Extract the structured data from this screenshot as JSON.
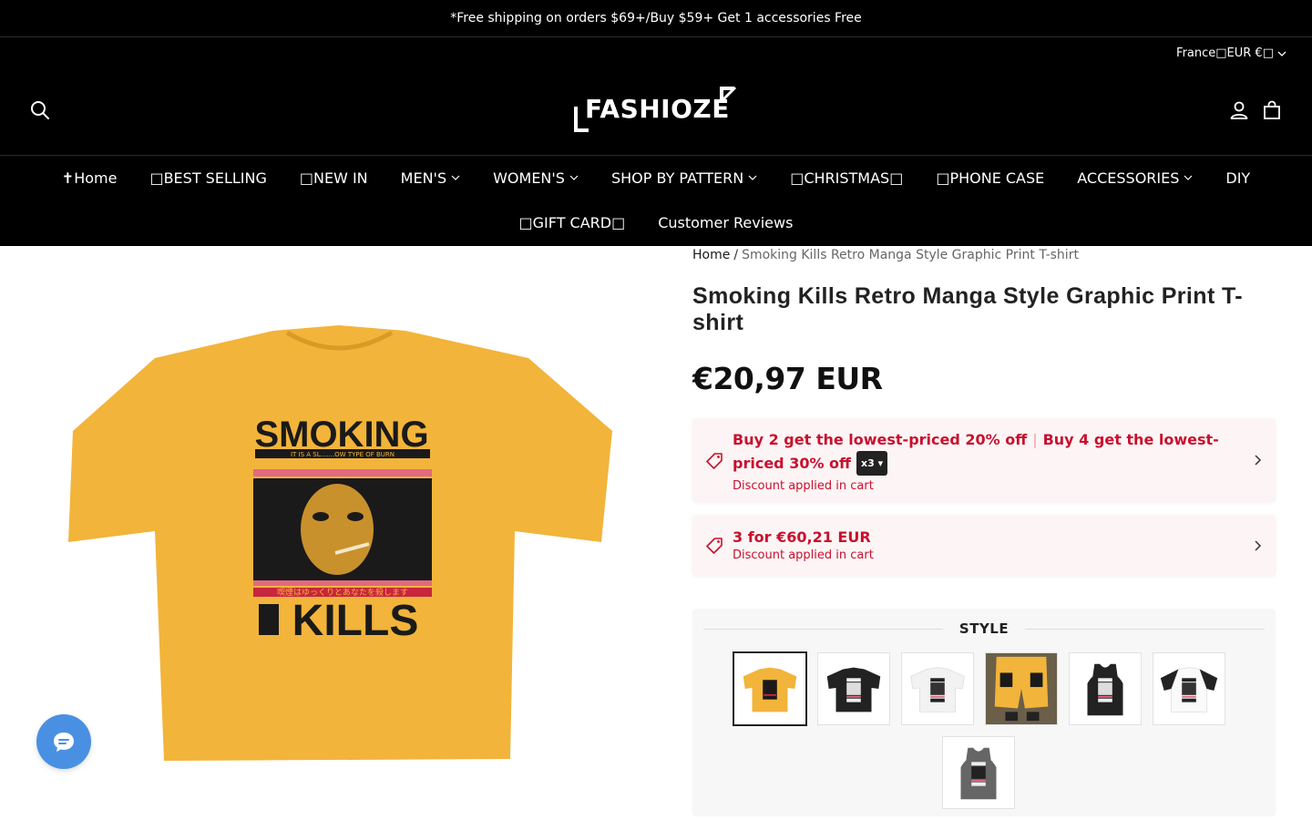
{
  "announcement": "*Free shipping on orders $69+/Buy $59+ Get 1 accessories Free",
  "header": {
    "currency": "France□EUR €□",
    "logo": "FASHIOZE"
  },
  "nav": {
    "row1": [
      {
        "label": "✝Home",
        "has_dropdown": false
      },
      {
        "label": "□BEST SELLING",
        "has_dropdown": false
      },
      {
        "label": "□NEW IN",
        "has_dropdown": false
      },
      {
        "label": "MEN'S",
        "has_dropdown": true
      },
      {
        "label": "WOMEN'S",
        "has_dropdown": true
      },
      {
        "label": "SHOP BY PATTERN",
        "has_dropdown": true
      },
      {
        "label": "□CHRISTMAS□",
        "has_dropdown": false
      },
      {
        "label": "□PHONE CASE",
        "has_dropdown": false
      },
      {
        "label": "ACCESSORIES",
        "has_dropdown": true
      },
      {
        "label": "DIY",
        "has_dropdown": false
      }
    ],
    "row2": [
      {
        "label": "□GIFT CARD□",
        "has_dropdown": false
      },
      {
        "label": "Customer Reviews",
        "has_dropdown": false
      }
    ]
  },
  "breadcrumb": {
    "home": "Home",
    "separator": "/",
    "current": "Smoking Kills Retro Manga Style Graphic Print T-shirt"
  },
  "product": {
    "title": "Smoking Kills Retro Manga Style Graphic Print T-shirt",
    "price": "€20,97 EUR",
    "image_text": {
      "top": "SMOKING",
      "tagline": "IT IS A SL.......OW TYPE OF BURN",
      "japanese": "喫煙はゆっくりとあなたを殺します",
      "bottom": "KILLS"
    }
  },
  "promos": [
    {
      "line1": "Buy 2 get the lowest-priced 20% off",
      "separator": "|",
      "line2": "Buy 4 get the lowest-priced 30% off",
      "qty": "x3",
      "sub": "Discount applied in cart"
    },
    {
      "line1": "3 for €60,21 EUR",
      "sub": "Discount applied in cart"
    }
  ],
  "style": {
    "heading": "STYLE",
    "swatches": [
      "yellow-tee",
      "black-tee",
      "white-tee",
      "yellow-shorts",
      "black-tank",
      "raglan-tee",
      "grey-tank"
    ],
    "selected_index": 0
  },
  "colors": {
    "accent_red": "#c8102e",
    "shirt_yellow": "#f2b43a",
    "chat_blue": "#4a90e2"
  }
}
